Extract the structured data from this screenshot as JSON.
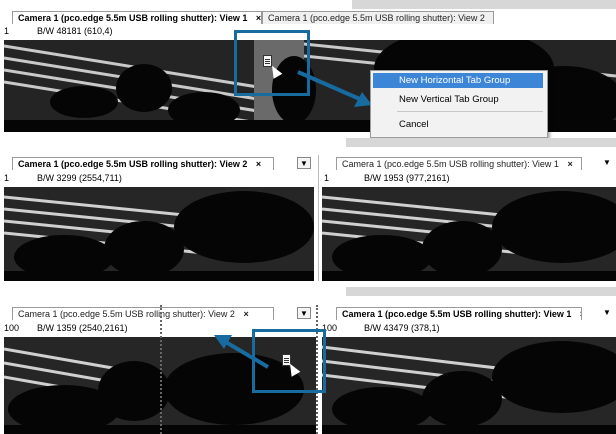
{
  "tab_full": "Camera 1 (pco.edge 5.5m USB rolling shutter): View 1",
  "tab_view2": "Camera 1 (pco.edge 5.5m USB rolling shutter): View 2",
  "tab_view1_short": "Camera 1 (pco.edge 5.5m USB rolling shutter): View 1",
  "close_glyph": "×",
  "dropdown_glyph": "▼",
  "panel1": {
    "zoom": "1",
    "info": "B/W 48181 (610,4)"
  },
  "context_menu": {
    "items": [
      {
        "label": "New Horizontal Tab Group"
      },
      {
        "label": "New Vertical Tab Group"
      },
      {
        "label": "Cancel"
      }
    ]
  },
  "panel2": {
    "left": {
      "zoom": "1",
      "info": "B/W 3299 (2554,711)"
    },
    "right": {
      "zoom": "1",
      "info": "B/W 1953 (977,2161)"
    }
  },
  "panel3": {
    "left": {
      "zoom": "100",
      "info": "B/W 1359 (2540,2161)"
    },
    "right": {
      "zoom": "100",
      "info": "B/W 43479 (378,1)"
    }
  },
  "colors": {
    "highlight_box": "#176b9e",
    "menu_highlight": "#3d85d6",
    "strip": "#d7d7d7"
  },
  "icons": [
    "document-icon",
    "mouse-cursor-icon",
    "arrow-icon"
  ]
}
